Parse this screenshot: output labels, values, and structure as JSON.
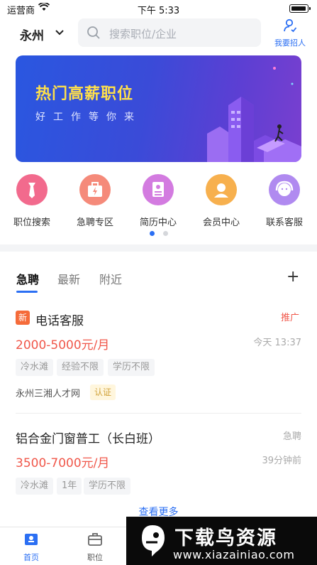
{
  "status_bar": {
    "carrier": "运营商",
    "time": "下午 5:33"
  },
  "header": {
    "city": "永州",
    "search_placeholder": "搜索职位/企业",
    "recruit_label": "我要招人"
  },
  "banner": {
    "title": "热门高薪职位",
    "subtitle": "好工作等你来"
  },
  "categories": [
    {
      "label": "职位搜索",
      "icon": "tie-icon",
      "color": "#f26a8d"
    },
    {
      "label": "急聘专区",
      "icon": "urgent-bag-icon",
      "color": "#f58a7a"
    },
    {
      "label": "简历中心",
      "icon": "resume-icon",
      "color": "#d37be0"
    },
    {
      "label": "会员中心",
      "icon": "member-icon",
      "color": "#f7b04e"
    },
    {
      "label": "联系客服",
      "icon": "service-icon",
      "color": "#b08af0"
    }
  ],
  "tabs": [
    "急聘",
    "最新",
    "附近"
  ],
  "jobs": [
    {
      "badge": "新",
      "title": "电话客服",
      "salary": "2000-5000元/月",
      "tag_right": "推广",
      "time": "今天 13:37",
      "tags": [
        "冷水滩",
        "经验不限",
        "学历不限"
      ],
      "company": "永州三湘人才网",
      "verified": "认证"
    },
    {
      "title": "铝合金门窗普工（长白班）",
      "salary": "3500-7000元/月",
      "tag_right": "急聘",
      "time": "39分钟前",
      "tags": [
        "冷水滩",
        "1年",
        "学历不限"
      ]
    }
  ],
  "more_label": "查看更多",
  "bottom_nav": [
    {
      "label": "首页",
      "icon": "home-icon",
      "active": true
    },
    {
      "label": "职位",
      "icon": "briefcase-icon",
      "active": false
    }
  ],
  "watermark": {
    "text": "下载鸟资源",
    "url": "www.xiazainiao.com"
  },
  "colors": {
    "accent": "#2b6ff3",
    "salary": "#f0574a",
    "banner_title": "#ffe04a"
  }
}
